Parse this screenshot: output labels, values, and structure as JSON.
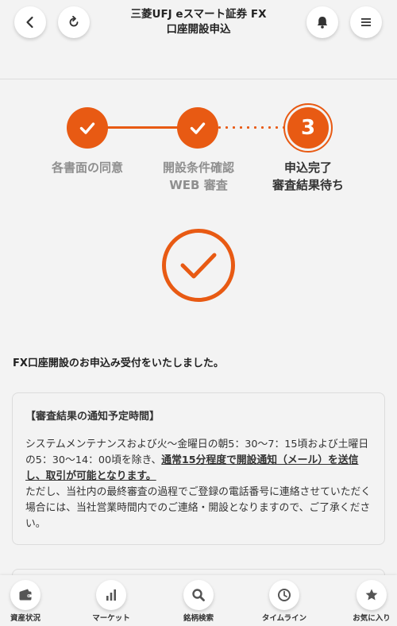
{
  "header": {
    "title_line1": "三菱UFJ eスマート証券 FX",
    "title_line2": "口座開設申込",
    "icons": [
      "back-icon",
      "refresh-icon",
      "bell-icon",
      "menu-icon"
    ]
  },
  "stepper": {
    "current_step_number": "3",
    "steps": [
      {
        "line1": "各書面の同意",
        "line2": "",
        "status": "done"
      },
      {
        "line1": "開設条件確認",
        "line2": "WEB 審査",
        "status": "done"
      },
      {
        "line1": "申込完了",
        "line2": "審査結果待ち",
        "status": "current"
      }
    ]
  },
  "message": {
    "received": "FX口座開設のお申込み受付をいたしました。"
  },
  "notice": {
    "title": "【審査結果の通知予定時間】",
    "body_part1": "システムメンテナンスおよび火〜金曜日の朝5：30〜7：15頃および土曜日の5：30〜14：00頃を除き、",
    "body_emphasis": "通常15分程度で開設通知（メール）を送信し、取引が可能となります。",
    "body_part2": "ただし、当社内の最終審査の過程でご登録の電話番号に連絡させていただく場合には、当社営業時間内でのご連絡・開設となりますので、ご了承ください。"
  },
  "tabs": [
    {
      "label": "資産状況",
      "icon": "wallet-icon"
    },
    {
      "label": "マーケット",
      "icon": "bar-chart-icon"
    },
    {
      "label": "銘柄検索",
      "icon": "search-icon"
    },
    {
      "label": "タイムライン",
      "icon": "clock-icon"
    },
    {
      "label": "お気に入り",
      "icon": "star-icon"
    }
  ],
  "colors": {
    "accent": "#e85a13",
    "background": "#f3f3f3",
    "muted_text": "#8f8f8f"
  }
}
